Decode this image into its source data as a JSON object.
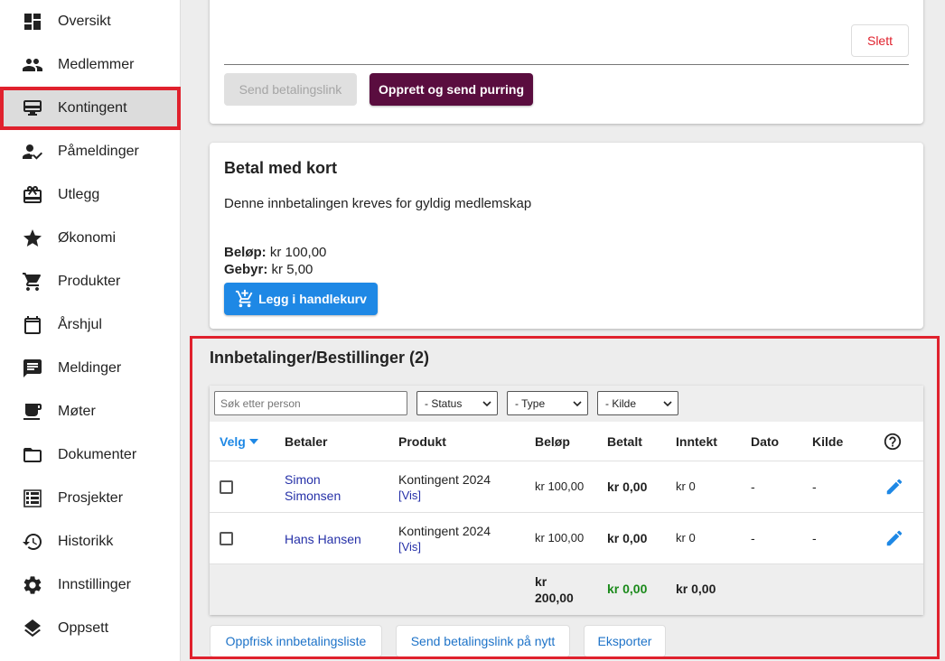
{
  "sidebar": {
    "items": [
      {
        "label": "Oversikt",
        "icon": "dashboard-icon"
      },
      {
        "label": "Medlemmer",
        "icon": "people-icon"
      },
      {
        "label": "Kontingent",
        "icon": "payment-card-icon"
      },
      {
        "label": "Påmeldinger",
        "icon": "person-check-icon"
      },
      {
        "label": "Utlegg",
        "icon": "gift-card-icon"
      },
      {
        "label": "Økonomi",
        "icon": "star-icon"
      },
      {
        "label": "Produkter",
        "icon": "cart-icon"
      },
      {
        "label": "Årshjul",
        "icon": "calendar-icon"
      },
      {
        "label": "Meldinger",
        "icon": "message-icon"
      },
      {
        "label": "Møter",
        "icon": "cup-icon"
      },
      {
        "label": "Dokumenter",
        "icon": "folder-icon"
      },
      {
        "label": "Prosjekter",
        "icon": "table-icon"
      },
      {
        "label": "Historikk",
        "icon": "history-icon"
      },
      {
        "label": "Innstillinger",
        "icon": "gear-icon"
      },
      {
        "label": "Oppsett",
        "icon": "layers-icon"
      }
    ],
    "active_index": 2
  },
  "top_card": {
    "delete_label": "Slett",
    "send_link_label": "Send betalingslink",
    "create_reminder_label": "Opprett og send purring"
  },
  "card_payment": {
    "title": "Betal med kort",
    "description": "Denne innbetalingen kreves for gyldig medlemskap",
    "amount_label": "Beløp:",
    "amount_value": "kr 100,00",
    "fee_label": "Gebyr:",
    "fee_value": "kr 5,00",
    "add_to_cart_label": "Legg i handlekurv"
  },
  "payments": {
    "title": "Innbetalinger/Bestillinger (2)",
    "search_placeholder": "Søk etter person",
    "filters": [
      "- Status",
      "- Type",
      "- Kilde"
    ],
    "columns": [
      "Velg",
      "Betaler",
      "Produkt",
      "Beløp",
      "Betalt",
      "Inntekt",
      "Dato",
      "Kilde"
    ],
    "rows": [
      {
        "payer_line1": "Simon",
        "payer_line2": "Simonsen",
        "product": "Kontingent 2024",
        "product_link": "[Vis]",
        "amount": "kr 100,00",
        "paid": "kr 0,00",
        "income": "kr 0",
        "date": "-",
        "source": "-"
      },
      {
        "payer_line1": "Hans Hansen",
        "payer_line2": "",
        "product": "Kontingent 2024",
        "product_link": "[Vis]",
        "amount": "kr 100,00",
        "paid": "kr 0,00",
        "income": "kr 0",
        "date": "-",
        "source": "-"
      }
    ],
    "totals": {
      "amount_line1": "kr",
      "amount_line2": "200,00",
      "paid": "kr 0,00",
      "income": "kr 0,00"
    },
    "actions": {
      "refresh_label": "Oppfrisk innbetalingsliste",
      "resend_label": "Send betalingslink på nytt",
      "export_label": "Eksporter"
    }
  },
  "colors": {
    "accent": "#1e88e5",
    "primary_dark": "#5a0d3f",
    "highlight_outline": "#e0212d",
    "danger_text": "#e0212d",
    "paid_total": "#1b8a1b"
  }
}
